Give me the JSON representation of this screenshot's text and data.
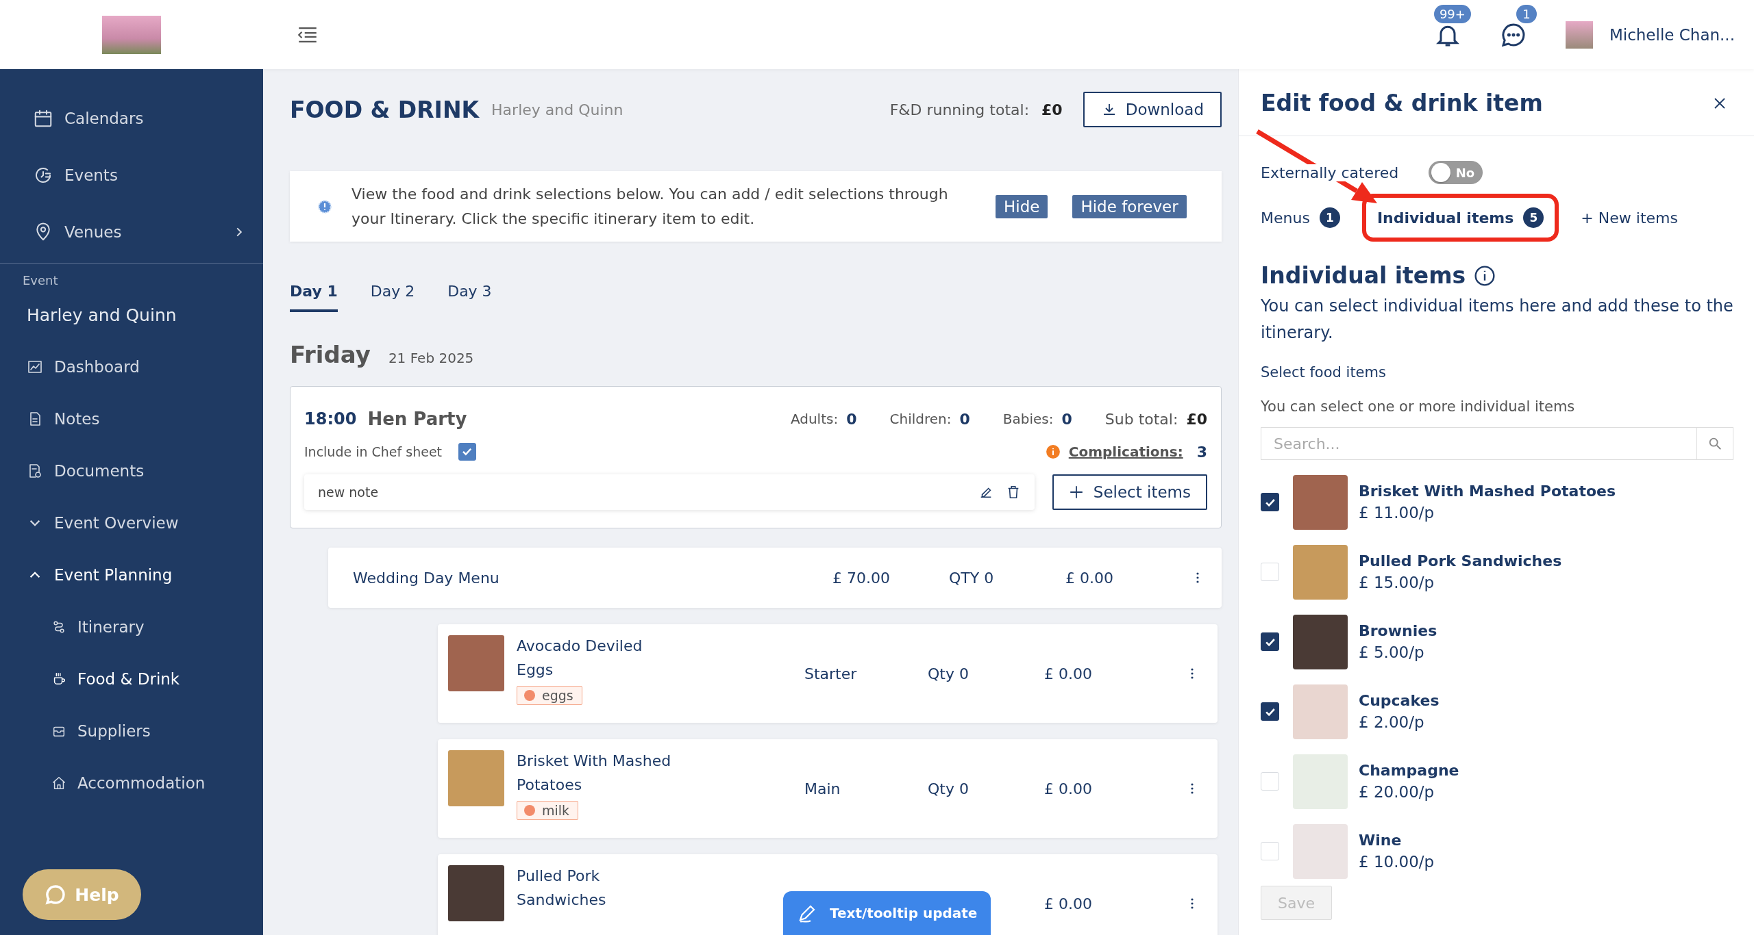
{
  "header": {
    "notifications_badge": "99+",
    "messages_badge": "1",
    "user_name": "Michelle Chan..."
  },
  "sidebar": {
    "top_items": [
      {
        "label": "Calendars",
        "has_submenu": false
      },
      {
        "label": "Events",
        "has_submenu": false
      },
      {
        "label": "Venues",
        "has_submenu": true
      }
    ],
    "section_label": "Event",
    "event_name": "Harley and Quinn",
    "items": [
      {
        "kind": "link",
        "label": "Dashboard",
        "selected": false
      },
      {
        "kind": "link",
        "label": "Notes",
        "selected": false
      },
      {
        "kind": "link",
        "label": "Documents",
        "selected": false
      },
      {
        "kind": "group",
        "label": "Event Overview",
        "expanded": false
      },
      {
        "kind": "group",
        "label": "Event Planning",
        "expanded": true,
        "children": [
          {
            "label": "Itinerary",
            "selected": false
          },
          {
            "label": "Food & Drink",
            "selected": true
          },
          {
            "label": "Suppliers",
            "selected": false
          },
          {
            "label": "Accommodation",
            "selected": false
          }
        ]
      }
    ],
    "help_button": "Help"
  },
  "main": {
    "title": "FOOD & DRINK",
    "event": "Harley and Quinn",
    "running_total_label": "F&D running total:",
    "running_total": "£0",
    "download": "Download",
    "notice": {
      "text": "View the food and drink selections below. You can add / edit selections through your Itinerary. Click the specific itinerary item to edit.",
      "buttons": [
        "Hide",
        "Hide forever"
      ]
    },
    "day_tabs": [
      {
        "label": "Day 1",
        "selected": true
      },
      {
        "label": "Day 2",
        "selected": false
      },
      {
        "label": "Day 3",
        "selected": false
      }
    ],
    "day": {
      "weekday": "Friday",
      "date": "21 Feb 2025"
    },
    "itinerary_item": {
      "time": "18:00",
      "name": "Hen Party",
      "counts": [
        {
          "label": "Adults:",
          "value": "0"
        },
        {
          "label": "Children:",
          "value": "0"
        },
        {
          "label": "Babies:",
          "value": "0"
        }
      ],
      "subtotal_label": "Sub total:",
      "subtotal": "£0",
      "chef_sheet_label": "Include in Chef sheet",
      "chef_sheet": true,
      "complications_label": "Complications:",
      "complications": "3",
      "note": "new note",
      "select_button": "Select items"
    },
    "menu": {
      "name": "Wedding Day Menu",
      "price": "£ 70.00",
      "qty": "QTY 0",
      "total": "£ 0.00"
    },
    "dishes": [
      {
        "name": "Avocado Deviled Eggs",
        "course": "Starter",
        "qty": "Qty 0",
        "total": "£ 0.00",
        "allergen": "eggs"
      },
      {
        "name": "Brisket With Mashed Potatoes",
        "course": "Main",
        "qty": "Qty 0",
        "total": "£ 0.00",
        "allergen": "milk"
      },
      {
        "name": "Pulled Pork Sandwiches",
        "total": "£ 0.00"
      }
    ],
    "floating_button": "Text/tooltip update"
  },
  "panel": {
    "title": "Edit food & drink item",
    "external_label": "Externally catered",
    "external_on": false,
    "toggle_text": "No",
    "tabs": [
      {
        "label": "Menus",
        "count": "1",
        "selected": false
      },
      {
        "label": "Individual items",
        "count": "5",
        "selected": true
      },
      {
        "label": "+ New items",
        "selected": false
      }
    ],
    "heading": "Individual items",
    "description": "You can select individual items here and add these to the itinerary.",
    "select_label": "Select food items",
    "hint": "You can select one or more individual items",
    "search_placeholder": "Search...",
    "items": [
      {
        "name": "Brisket With Mashed Potatoes",
        "price": "£ 11.00/p",
        "checked": true
      },
      {
        "name": "Pulled Pork Sandwiches",
        "price": "£ 15.00/p",
        "checked": false
      },
      {
        "name": "Brownies",
        "price": "£ 5.00/p",
        "checked": true
      },
      {
        "name": "Cupcakes",
        "price": "£ 2.00/p",
        "checked": true
      },
      {
        "name": "Champagne",
        "price": "£ 20.00/p",
        "checked": false
      },
      {
        "name": "Wine",
        "price": "£ 10.00/p",
        "checked": false
      }
    ],
    "save": "Save",
    "save_disabled": true
  }
}
